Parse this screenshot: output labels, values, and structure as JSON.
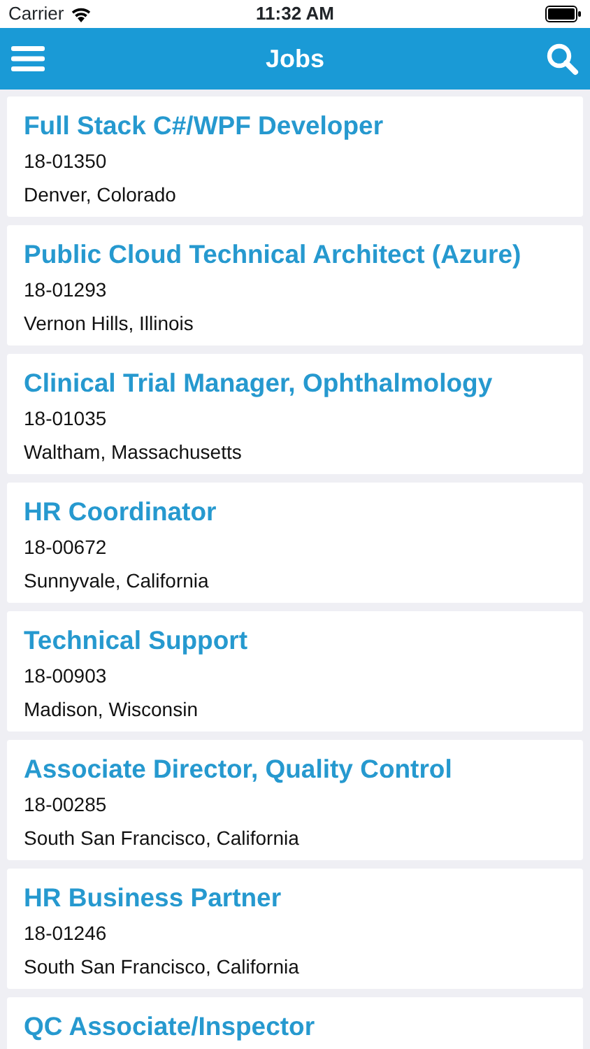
{
  "status_bar": {
    "carrier": "Carrier",
    "time": "11:32 AM"
  },
  "header": {
    "title": "Jobs"
  },
  "jobs": [
    {
      "title": "Full Stack C#/WPF Developer",
      "number": "18-01350",
      "location": "Denver, Colorado"
    },
    {
      "title": "Public Cloud Technical Architect (Azure)",
      "number": "18-01293",
      "location": "Vernon Hills, Illinois"
    },
    {
      "title": "Clinical Trial Manager, Ophthalmology",
      "number": "18-01035",
      "location": "Waltham, Massachusetts"
    },
    {
      "title": "HR Coordinator",
      "number": "18-00672",
      "location": "Sunnyvale, California"
    },
    {
      "title": "Technical Support",
      "number": "18-00903",
      "location": "Madison, Wisconsin"
    },
    {
      "title": "Associate Director, Quality Control",
      "number": "18-00285",
      "location": "South San Francisco, California"
    },
    {
      "title": "HR Business Partner",
      "number": "18-01246",
      "location": "South San Francisco, California"
    },
    {
      "title": "QC Associate/Inspector"
    }
  ]
}
